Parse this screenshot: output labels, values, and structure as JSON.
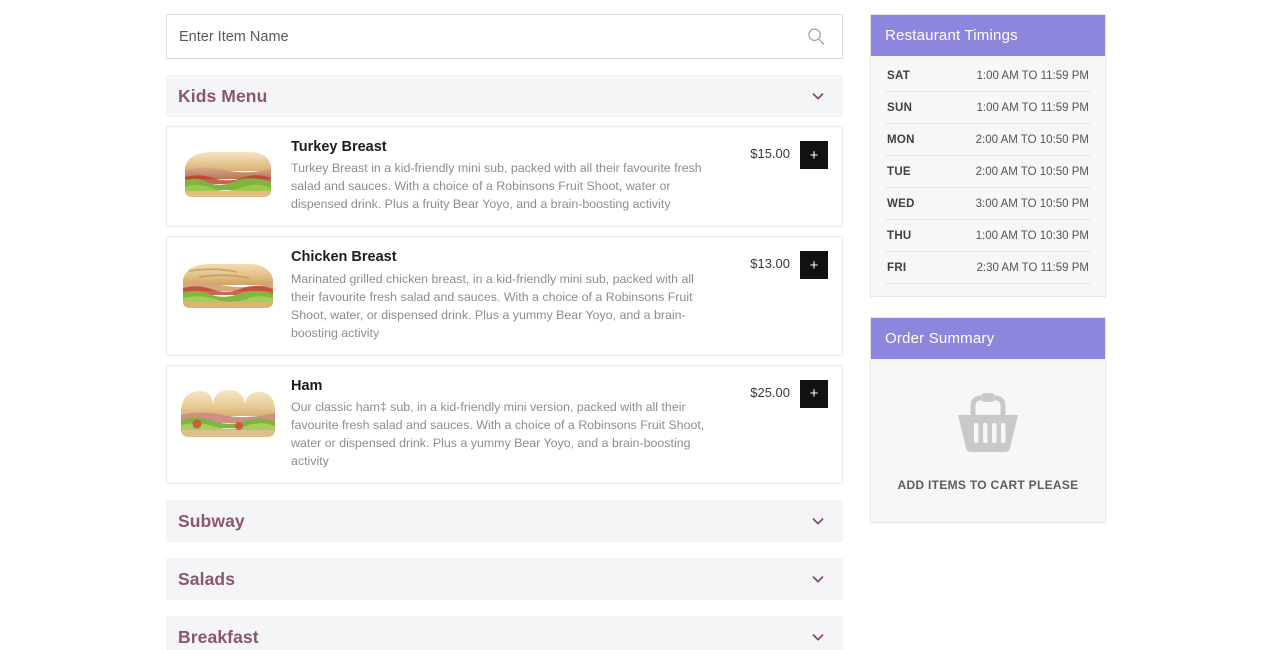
{
  "search": {
    "placeholder": "Enter Item Name",
    "value": "",
    "icon": "search-icon"
  },
  "menu": {
    "categories": [
      {
        "name": "Kids Menu",
        "expanded": true,
        "chevron_icon": "chevron-down-icon",
        "items": [
          {
            "name": "Turkey Breast",
            "description": "Turkey Breast in a kid-friendly mini sub, packed with all their favourite fresh salad and sauces. With a choice of a Robinsons Fruit Shoot, water or dispensed drink. Plus a fruity Bear Yoyo, and a brain-boosting activity",
            "price": "$15.00",
            "add_label": "+",
            "image": "turkey-breast-sub-photo"
          },
          {
            "name": "Chicken Breast",
            "description": "Marinated grilled chicken breast, in a kid-friendly mini sub, packed with all their favourite fresh salad and sauces. With a choice of a Robinsons Fruit Shoot, water, or dispensed drink. Plus a yummy Bear Yoyo, and a brain-boosting activity",
            "price": "$13.00",
            "add_label": "+",
            "image": "chicken-breast-sub-photo"
          },
          {
            "name": "Ham",
            "description": "Our classic ham‡ sub, in a kid-friendly mini version, packed with all their favourite fresh salad and sauces. With a choice of a Robinsons Fruit Shoot, water or dispensed drink. Plus a yummy Bear Yoyo, and a brain-boosting activity",
            "price": "$25.00",
            "add_label": "+",
            "image": "ham-sub-photo"
          }
        ]
      },
      {
        "name": "Subway",
        "expanded": false,
        "chevron_icon": "chevron-down-icon",
        "items": []
      },
      {
        "name": "Salads",
        "expanded": false,
        "chevron_icon": "chevron-down-icon",
        "items": []
      },
      {
        "name": "Breakfast",
        "expanded": false,
        "chevron_icon": "chevron-down-icon",
        "items": []
      }
    ]
  },
  "timings_panel": {
    "title": "Restaurant Timings",
    "rows": [
      {
        "day": "SAT",
        "hours": "1:00 AM TO 11:59 PM"
      },
      {
        "day": "SUN",
        "hours": "1:00 AM TO 11:59 PM"
      },
      {
        "day": "MON",
        "hours": "2:00 AM TO 10:50 PM"
      },
      {
        "day": "TUE",
        "hours": "2:00 AM TO 10:50 PM"
      },
      {
        "day": "WED",
        "hours": "3:00 AM TO 10:50 PM"
      },
      {
        "day": "THU",
        "hours": "1:00 AM TO 10:30 PM"
      },
      {
        "day": "FRI",
        "hours": "2:30 AM TO 11:59 PM"
      }
    ]
  },
  "order_summary": {
    "title": "Order Summary",
    "empty_text": "ADD ITEMS TO CART PLEASE",
    "empty_icon": "shopping-basket-icon"
  },
  "colors": {
    "panel_header_purple": "#8d86dd",
    "category_title_plum": "#8a5670",
    "accordion_bg": "#f5f4f6",
    "add_button_black": "#111111",
    "page_bg": "#ffffff"
  }
}
